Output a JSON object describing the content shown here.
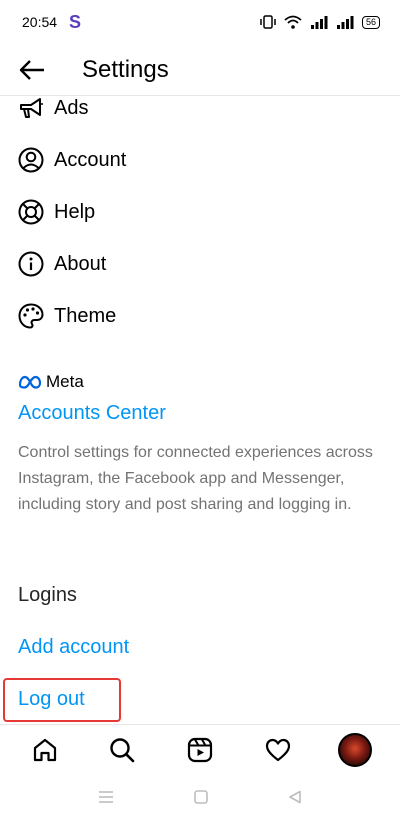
{
  "status_bar": {
    "time": "20:54",
    "app_badge": "S",
    "battery": "56"
  },
  "header": {
    "title": "Settings"
  },
  "menu": [
    {
      "label": "Ads",
      "icon": "megaphone-icon"
    },
    {
      "label": "Account",
      "icon": "account-circle-icon"
    },
    {
      "label": "Help",
      "icon": "lifebuoy-icon"
    },
    {
      "label": "About",
      "icon": "info-icon"
    },
    {
      "label": "Theme",
      "icon": "palette-icon"
    }
  ],
  "meta_section": {
    "logo_text": "Meta",
    "accounts_center": "Accounts Center",
    "description": "Control settings for connected experiences across Instagram, the Facebook app and Messenger, including story and post sharing and logging in."
  },
  "logins": {
    "heading": "Logins",
    "add_account": "Add account",
    "log_out": "Log out"
  },
  "colors": {
    "link": "#0095f6",
    "highlight": "#e53935",
    "muted": "#737373"
  }
}
